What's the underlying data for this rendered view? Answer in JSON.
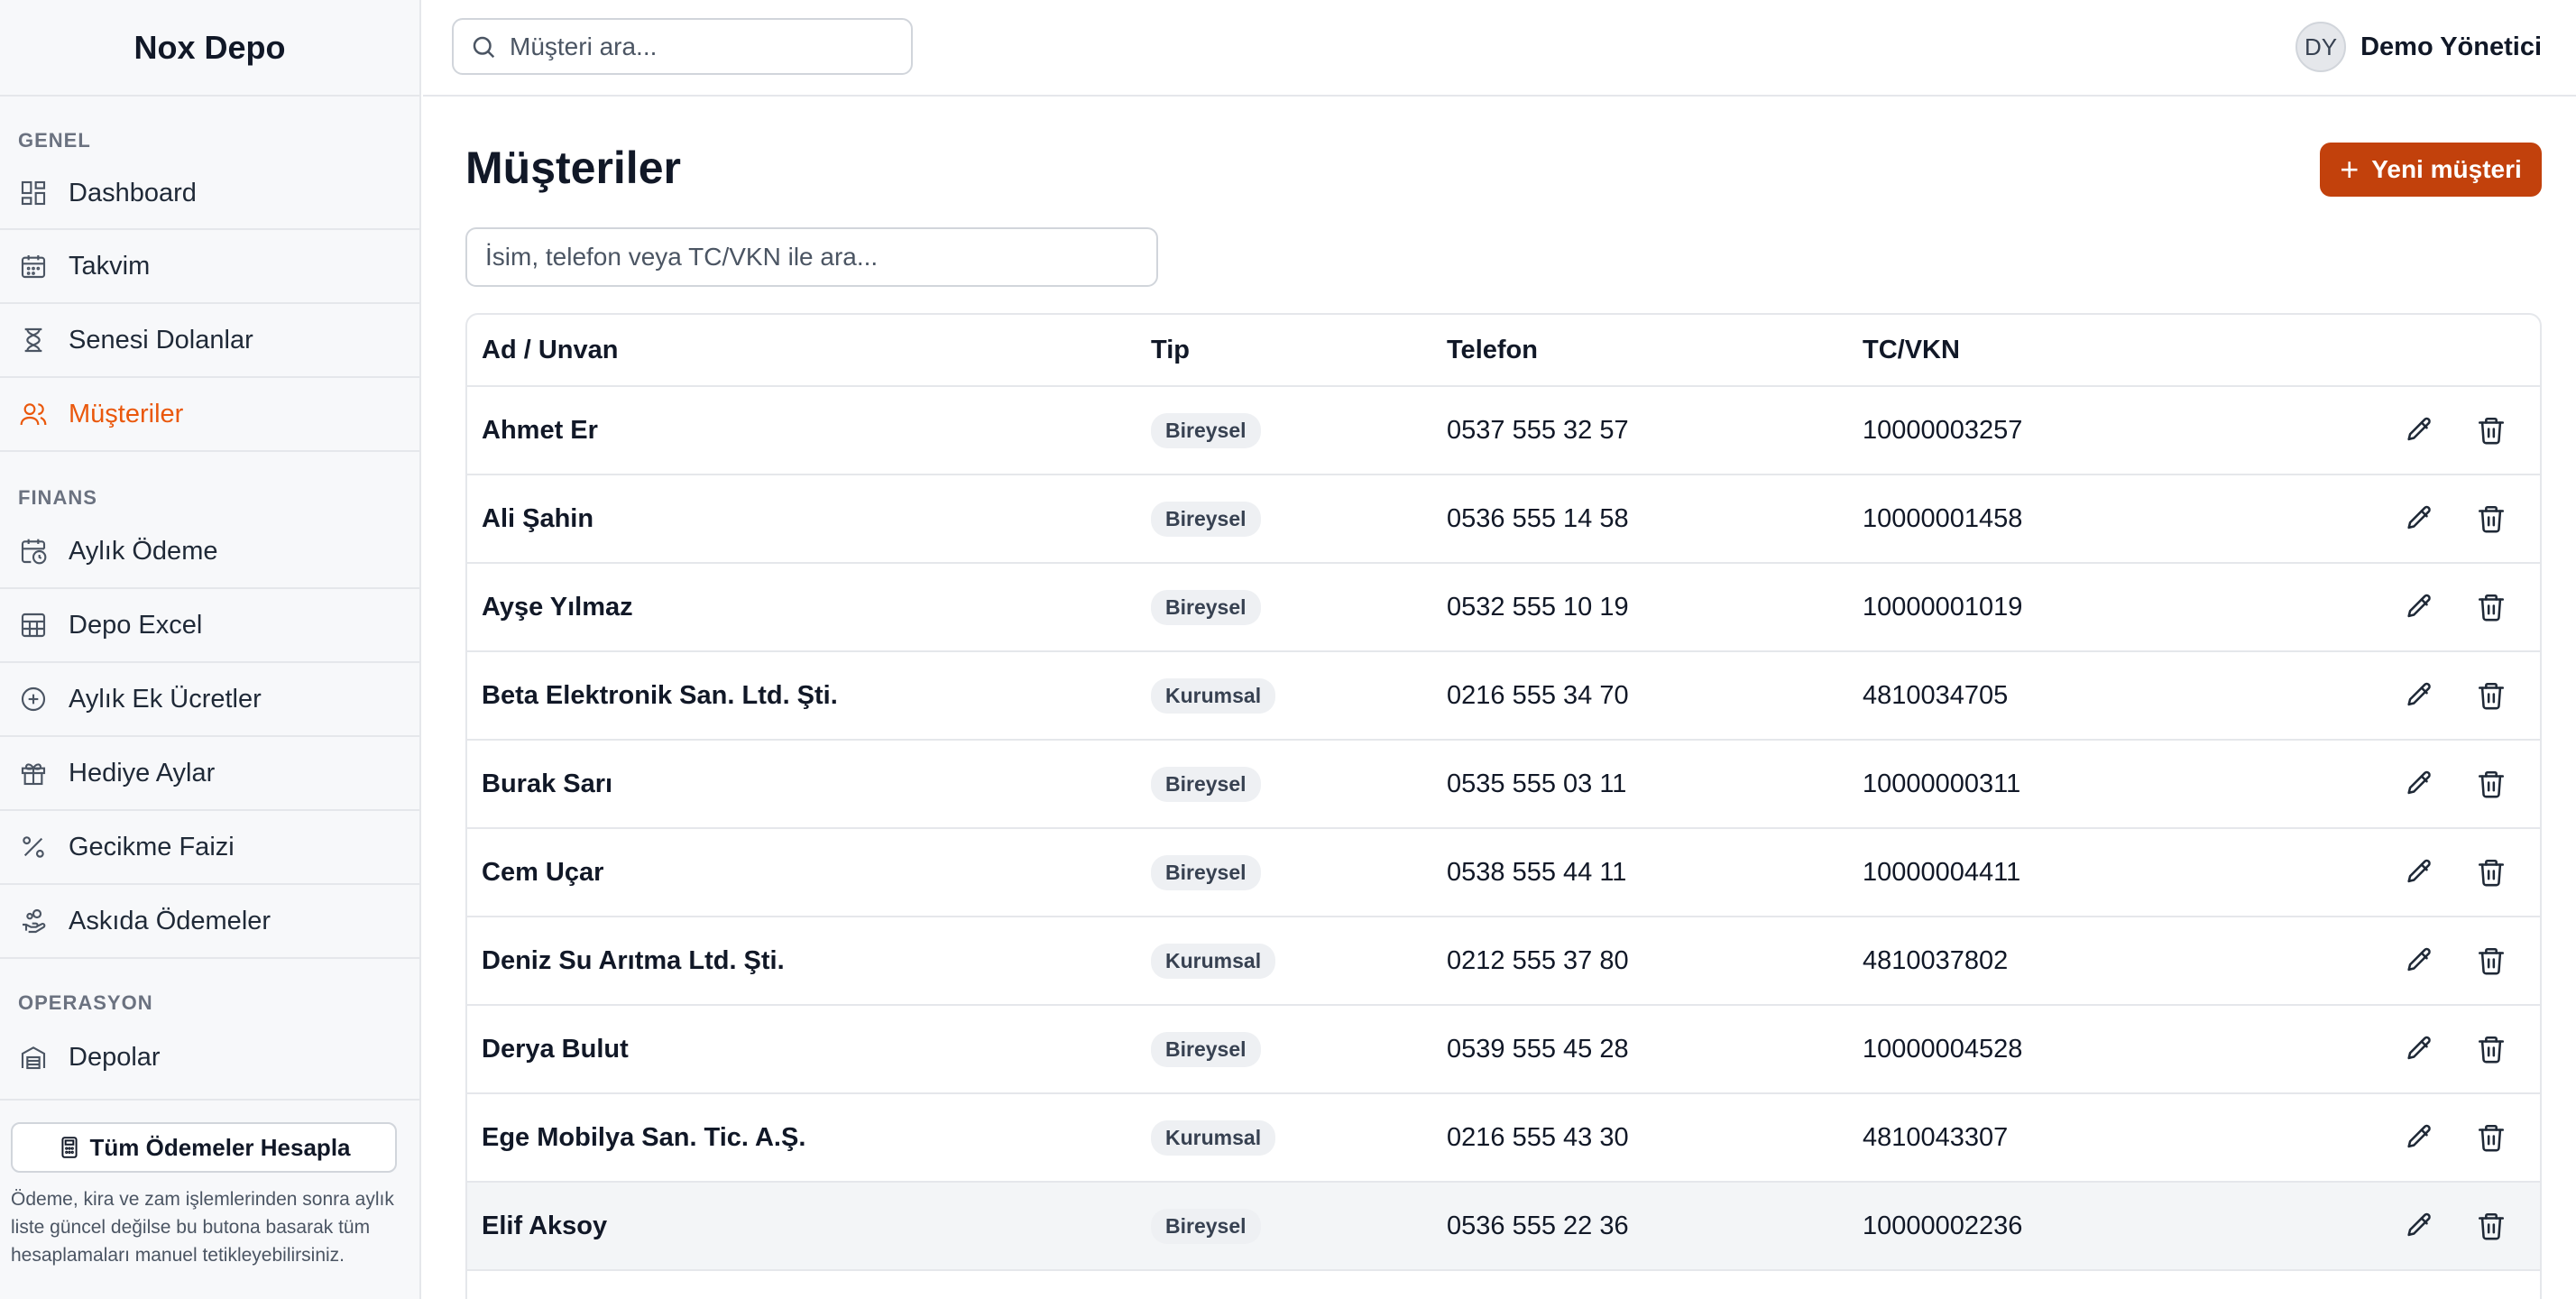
{
  "app": {
    "brand": "Nox Depo"
  },
  "topbar": {
    "search_placeholder": "Müşteri ara...",
    "user_initials": "DY",
    "user_name": "Demo Yönetici"
  },
  "sidebar": {
    "sections": {
      "genel": "GENEL",
      "finans": "FINANS",
      "operasyon": "OPERASYON"
    },
    "items": [
      {
        "label": "Dashboard",
        "icon": "dashboard-icon"
      },
      {
        "label": "Takvim",
        "icon": "calendar-icon"
      },
      {
        "label": "Senesi Dolanlar",
        "icon": "hourglass-icon"
      },
      {
        "label": "Müşteriler",
        "icon": "users-icon",
        "active": true
      },
      {
        "label": "Aylık Ödeme",
        "icon": "calendar-clock-icon"
      },
      {
        "label": "Depo Excel",
        "icon": "table-icon"
      },
      {
        "label": "Aylık Ek Ücretler",
        "icon": "plus-circle-icon"
      },
      {
        "label": "Hediye Aylar",
        "icon": "gift-icon"
      },
      {
        "label": "Gecikme Faizi",
        "icon": "percent-icon"
      },
      {
        "label": "Askıda Ödemeler",
        "icon": "hand-coins-icon"
      },
      {
        "label": "Depolar",
        "icon": "warehouse-icon"
      }
    ],
    "calc_button": "Tüm Ödemeler Hesapla",
    "footer_note": "Ödeme, kira ve zam işlemlerinden sonra aylık liste güncel değilse bu butona basarak tüm hesaplamaları manuel tetikleyebilirsiniz."
  },
  "main": {
    "title": "Müşteriler",
    "new_button": "Yeni müşteri",
    "filter_placeholder": "İsim, telefon veya TC/VKN ile ara...",
    "columns": [
      "Ad / Unvan",
      "Tip",
      "Telefon",
      "TC/VKN"
    ],
    "rows": [
      {
        "name": "Ahmet Er",
        "type": "Bireysel",
        "phone": "0537 555 32 57",
        "tc": "10000003257"
      },
      {
        "name": "Ali Şahin",
        "type": "Bireysel",
        "phone": "0536 555 14 58",
        "tc": "10000001458"
      },
      {
        "name": "Ayşe Yılmaz",
        "type": "Bireysel",
        "phone": "0532 555 10 19",
        "tc": "10000001019"
      },
      {
        "name": "Beta Elektronik San. Ltd. Şti.",
        "type": "Kurumsal",
        "phone": "0216 555 34 70",
        "tc": "4810034705"
      },
      {
        "name": "Burak Sarı",
        "type": "Bireysel",
        "phone": "0535 555 03 11",
        "tc": "10000000311"
      },
      {
        "name": "Cem Uçar",
        "type": "Bireysel",
        "phone": "0538 555 44 11",
        "tc": "10000004411"
      },
      {
        "name": "Deniz Su Arıtma Ltd. Şti.",
        "type": "Kurumsal",
        "phone": "0212 555 37 80",
        "tc": "4810037802"
      },
      {
        "name": "Derya Bulut",
        "type": "Bireysel",
        "phone": "0539 555 45 28",
        "tc": "10000004528"
      },
      {
        "name": "Ege Mobilya San. Tic. A.Ş.",
        "type": "Kurumsal",
        "phone": "0216 555 43 30",
        "tc": "4810043307"
      },
      {
        "name": "Elif Aksoy",
        "type": "Bireysel",
        "phone": "0536 555 22 36",
        "tc": "10000002236"
      }
    ]
  },
  "colors": {
    "accent": "#ea580c",
    "primary_button": "#c2410c"
  }
}
